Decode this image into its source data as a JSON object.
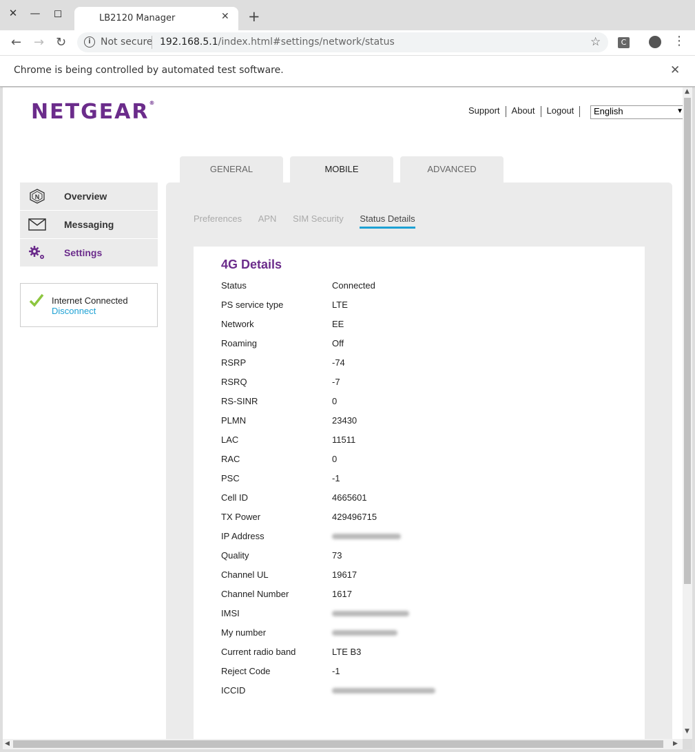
{
  "browser": {
    "tab_title": "LB2120 Manager",
    "tab_close": "✕",
    "new_tab": "+",
    "security_label": "Not secure",
    "url_host": "192.168.5.1",
    "url_path": "/index.html#settings/network/status",
    "extension_label": "C",
    "infobar_text": "Chrome is being controlled by automated test software.",
    "window_close": "✕",
    "window_minimize": "—",
    "window_maximize": "◻"
  },
  "header": {
    "brand": "NETGEAR",
    "brand_mark": "®",
    "links": [
      "Support",
      "About",
      "Logout"
    ],
    "language": "English"
  },
  "main_tabs": [
    {
      "label": "GENERAL"
    },
    {
      "label": "MOBILE"
    },
    {
      "label": "ADVANCED"
    }
  ],
  "sidebar": {
    "items": [
      {
        "label": "Overview",
        "icon": "netgear-n-icon"
      },
      {
        "label": "Messaging",
        "icon": "envelope-icon"
      },
      {
        "label": "Settings",
        "icon": "gears-icon"
      }
    ]
  },
  "connection": {
    "status": "Internet Connected",
    "action": "Disconnect"
  },
  "sub_tabs": [
    "Preferences",
    "APN",
    "SIM Security",
    "Status Details"
  ],
  "details": {
    "title": "4G Details",
    "rows": [
      {
        "key": "Status",
        "value": "Connected"
      },
      {
        "key": "PS service type",
        "value": "LTE"
      },
      {
        "key": "Network",
        "value": "EE"
      },
      {
        "key": "Roaming",
        "value": "Off"
      },
      {
        "key": "RSRP",
        "value": "-74"
      },
      {
        "key": "RSRQ",
        "value": "-7"
      },
      {
        "key": "RS-SINR",
        "value": "0"
      },
      {
        "key": "PLMN",
        "value": "23430"
      },
      {
        "key": "LAC",
        "value": "11511"
      },
      {
        "key": "RAC",
        "value": "0"
      },
      {
        "key": "PSC",
        "value": "-1"
      },
      {
        "key": "Cell ID",
        "value": "4665601"
      },
      {
        "key": "TX Power",
        "value": "429496715"
      },
      {
        "key": "IP Address",
        "value": ""
      },
      {
        "key": "Quality",
        "value": "73"
      },
      {
        "key": "Channel UL",
        "value": "19617"
      },
      {
        "key": "Channel Number",
        "value": "1617"
      },
      {
        "key": "IMSI",
        "value": ""
      },
      {
        "key": "My number",
        "value": ""
      },
      {
        "key": "Current radio band",
        "value": "LTE B3"
      },
      {
        "key": "Reject Code",
        "value": "-1"
      },
      {
        "key": "ICCID",
        "value": ""
      }
    ]
  },
  "colors": {
    "brand_purple": "#6b2c8b",
    "link_blue": "#1da1d4",
    "check_green": "#8dc63f"
  }
}
